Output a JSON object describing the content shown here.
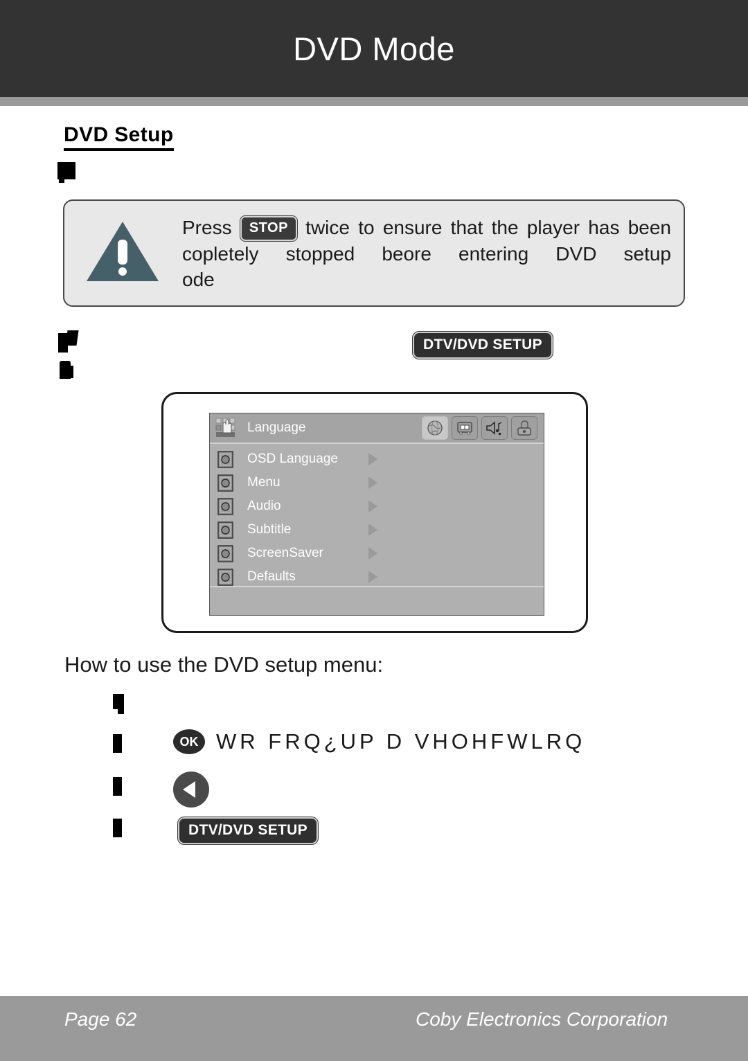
{
  "header": {
    "title": "DVD Mode"
  },
  "section": {
    "heading": "DVD Setup"
  },
  "warning": {
    "icon": "warning-triangle-icon",
    "line1_before": "Press",
    "key_label": "STOP",
    "line1_after": "twice to ensure that the player has been",
    "line2": "copletely stopped beore entering DVD setup",
    "line3": "ode",
    "box_color": "#e8e8e8",
    "triangle_color": "#46606a"
  },
  "setup_badge": {
    "label": "DTV/DVD SETUP"
  },
  "osd": {
    "title": "Language",
    "hand_icon": "hand-pointer-icon",
    "tabs": [
      {
        "name": "globe-icon",
        "selected": true
      },
      {
        "name": "tv-display-icon",
        "selected": false
      },
      {
        "name": "speaker-audio-icon",
        "selected": false
      },
      {
        "name": "lock-icon",
        "selected": false
      }
    ],
    "rows": [
      {
        "label": "OSD Language"
      },
      {
        "label": "Menu"
      },
      {
        "label": "Audio"
      },
      {
        "label": "Subtitle"
      },
      {
        "label": "ScreenSaver"
      },
      {
        "label": "Defaults"
      }
    ]
  },
  "howto": {
    "heading": "How to use the DVD setup menu:",
    "ok_button_label": "OK",
    "ok_line_text": "WR FRQ¿UP D VHOHFWLRQ",
    "back_button_icon": "back-triangle-icon",
    "setup_badge_label": "DTV/DVD SETUP"
  },
  "footer": {
    "page_label": "Page 62",
    "company": "Coby Electronics Corporation"
  }
}
